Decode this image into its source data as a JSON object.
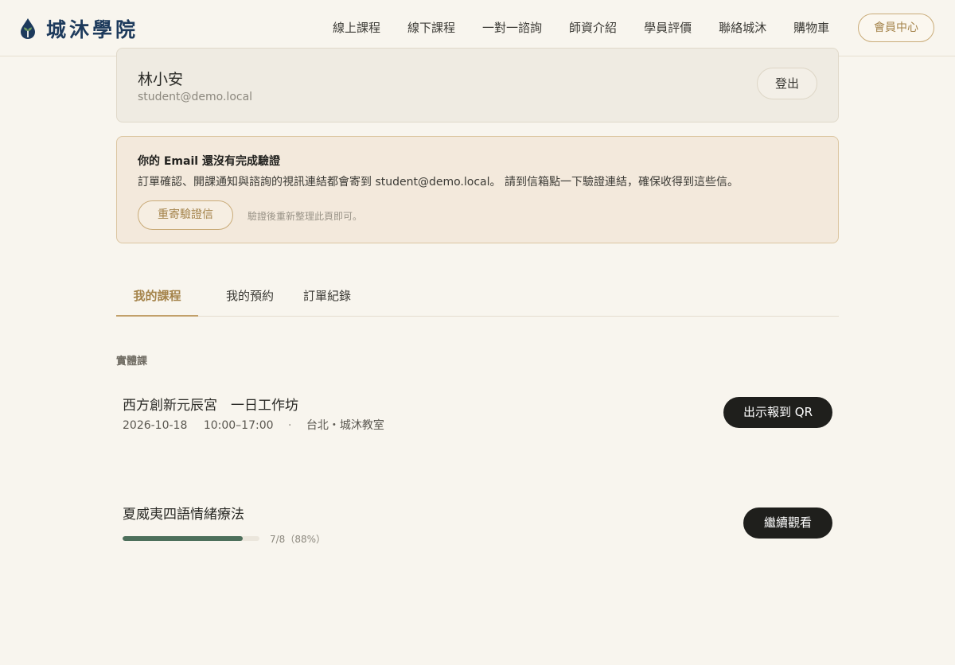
{
  "brand": {
    "name": "城沐學院",
    "logo_icon": "water-drop-sprout-icon",
    "logo_color": "#1d3a5c"
  },
  "nav": {
    "items": [
      "線上課程",
      "線下課程",
      "一對一諮詢",
      "師資介紹",
      "學員評價",
      "聯絡城沐",
      "購物車"
    ],
    "member_button": "會員中心"
  },
  "profile": {
    "name": "林小安",
    "email": "student@demo.local",
    "logout_label": "登出"
  },
  "verify_alert": {
    "title": "你的 Email 還沒有完成驗證",
    "body": "訂單確認、開課通知與諮詢的視訊連結都會寄到 student@demo.local。 請到信箱點一下驗證連結，確保收得到這些信。",
    "resend_label": "重寄驗證信",
    "hint": "驗證後重新整理此頁即可。"
  },
  "tabs": [
    {
      "label": "我的課程",
      "active": true
    },
    {
      "label": "我的預約",
      "active": false
    },
    {
      "label": "訂單紀錄",
      "active": false
    }
  ],
  "section_label": "實體課",
  "courses": [
    {
      "title": "西方創新元辰宮　一日工作坊",
      "date": "2026-10-18",
      "time": "10:00–17:00",
      "separator": "·",
      "location": "台北・城沐教室",
      "action_label": "出示報到 QR"
    },
    {
      "title": "夏威夷四語情緒療法",
      "progress_label": "7/8（88%）",
      "progress_fraction": 0.88,
      "action_label": "繼續觀看"
    }
  ],
  "colors": {
    "accent": "#a4834a",
    "progress": "#4d6f5b",
    "background": "#f8f5ee",
    "dark_button": "#1f1f1c"
  }
}
